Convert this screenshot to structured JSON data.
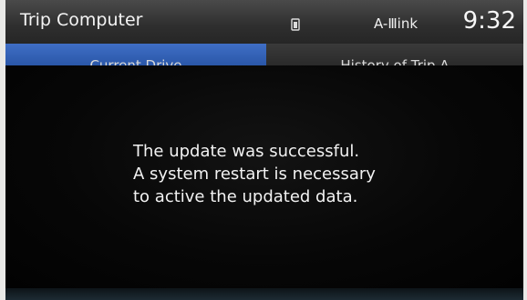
{
  "header": {
    "title": "Trip Computer",
    "link_label": "A-Ⅲink",
    "time": "9:32",
    "status_icon": "phone-battery-icon"
  },
  "tabs": [
    {
      "label": "Current Drive"
    },
    {
      "label": "History of Trip A"
    }
  ],
  "message": {
    "lines": [
      "The update was successful.",
      "A system restart is necessary",
      "to active the updated data."
    ]
  },
  "colors": {
    "tab_active": "#3f6fc6",
    "header": "#3a3a3a",
    "background": "#050505",
    "text": "#f2f2f2"
  }
}
